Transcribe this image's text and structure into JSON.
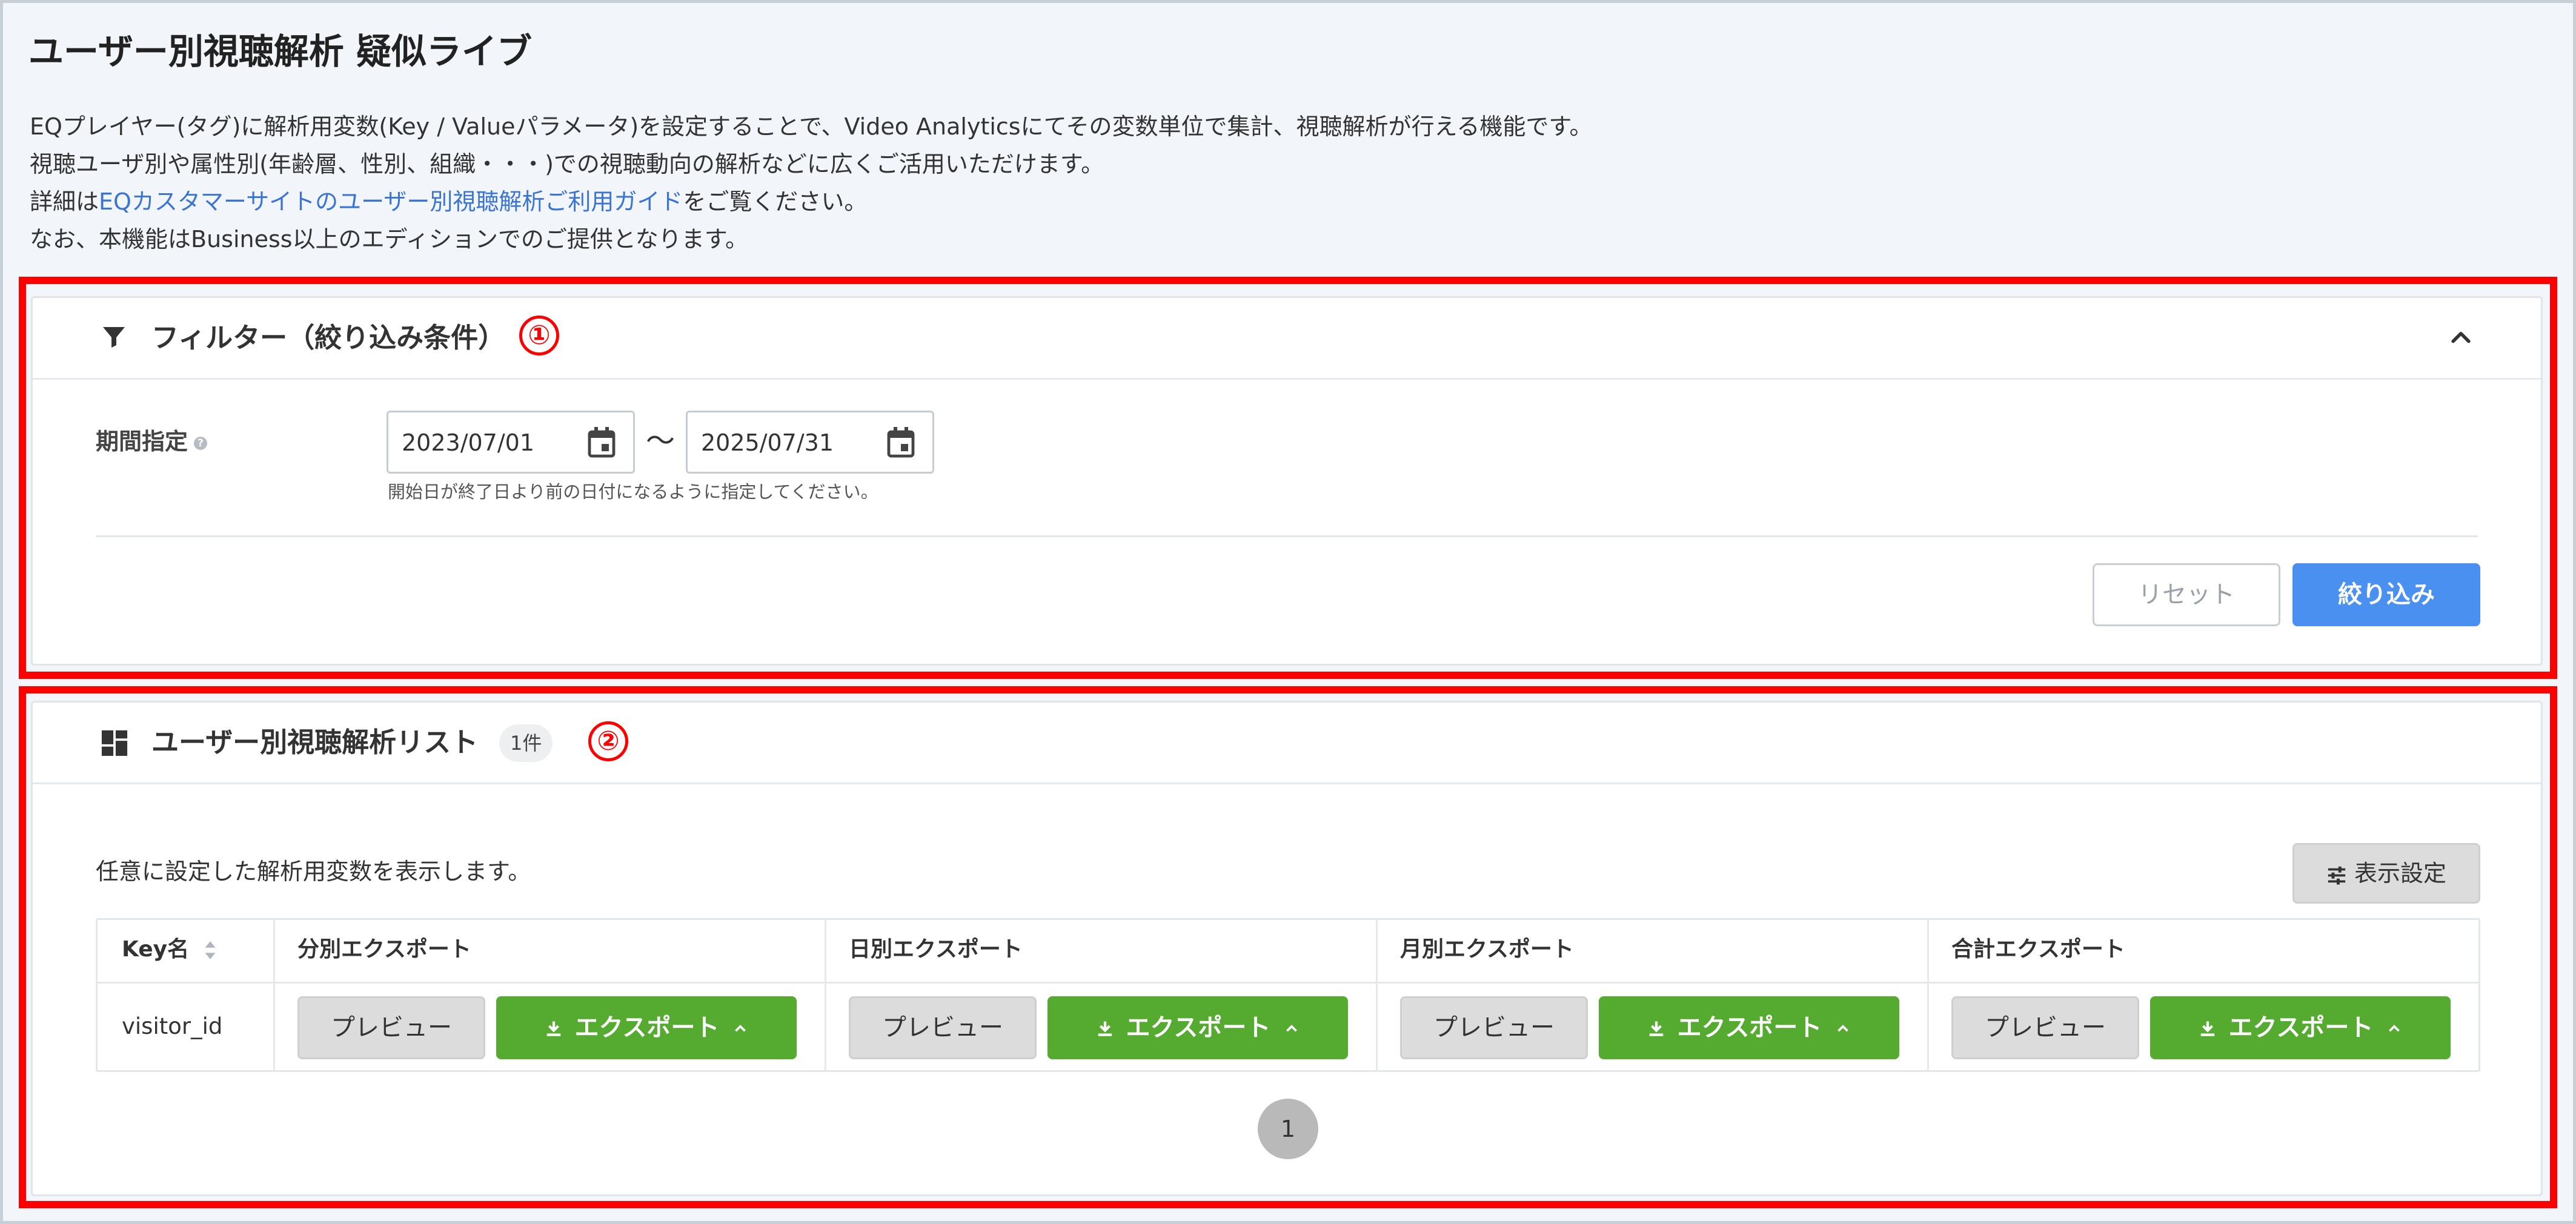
{
  "page": {
    "title": "ユーザー別視聴解析 疑似ライブ",
    "description": {
      "line1": "EQプレイヤー(タグ)に解析用変数(Key / Valueパラメータ)を設定することで、Video Analyticsにてその変数単位で集計、視聴解析が行える機能です。",
      "line2": "視聴ユーザ別や属性別(年齢層、性別、組織・・・)での視聴動向の解析などに広くご活用いただけます。",
      "line3_prefix": "詳細は",
      "line3_link": "EQカスタマーサイトのユーザー別視聴解析ご利用ガイド",
      "line3_suffix": "をご覧ください。",
      "line4": "なお、本機能はBusiness以上のエディションでのご提供となります。"
    }
  },
  "annotations": {
    "marker1": "①",
    "marker2": "②",
    "frame_color": "#ff0000"
  },
  "filter": {
    "title": "フィルター（絞り込み条件）",
    "icon": "filter-icon",
    "collapse_icon": "chevron-up-icon",
    "period_label": "期間指定",
    "help_icon": "?",
    "start_date": "2023/07/01",
    "end_date": "2025/07/31",
    "separator": "〜",
    "hint": "開始日が終了日より前の日付になるように指定してください。",
    "reset_label": "リセット",
    "apply_label": "絞り込み"
  },
  "list": {
    "title": "ユーザー別視聴解析リスト",
    "icon": "dashboard-icon",
    "count_badge": "1件",
    "description": "任意に設定した解析用変数を表示します。",
    "display_settings_label": "表示設定",
    "columns": [
      "Key名",
      "分別エクスポート",
      "日別エクスポート",
      "月別エクスポート",
      "合計エクスポート"
    ],
    "rows": [
      {
        "key": "visitor_id",
        "preview_label": "プレビュー",
        "export_label": "エクスポート"
      }
    ],
    "pagination": {
      "current": "1"
    }
  },
  "colors": {
    "accent_blue": "#4a90f0",
    "export_green": "#55ab2f",
    "link_blue": "#3a74d4"
  }
}
